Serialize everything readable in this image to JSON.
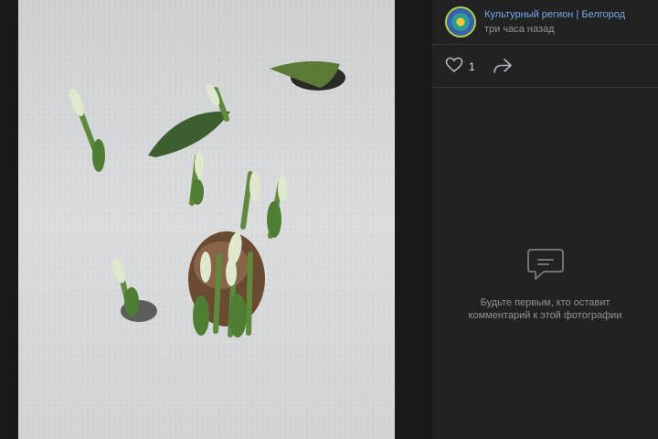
{
  "post": {
    "author": "Культурный регион | Белгород",
    "time": "три часа назад",
    "likes": "1"
  },
  "comments": {
    "empty_line1": "Будьте первым, кто оставит",
    "empty_line2": "комментарий к этой фотографии"
  },
  "icons": {
    "like": "heart-icon",
    "share": "share-arrow-icon",
    "comments": "speech-bubble-icon"
  },
  "colors": {
    "link": "#71aaeb",
    "panel": "#222223",
    "background": "#19191a"
  }
}
